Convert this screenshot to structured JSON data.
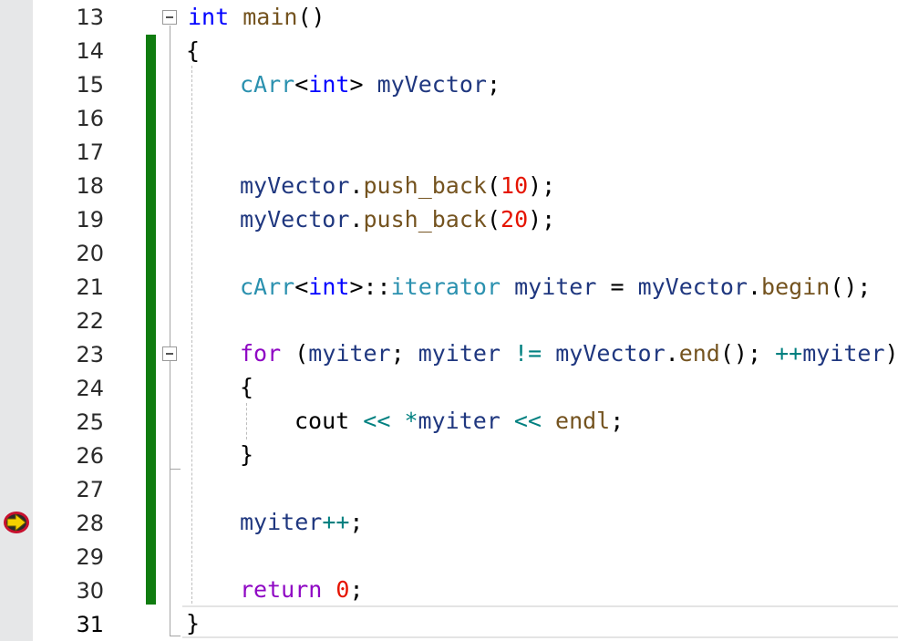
{
  "line_numbers": [
    "13",
    "14",
    "15",
    "16",
    "17",
    "18",
    "19",
    "20",
    "21",
    "22",
    "23",
    "24",
    "25",
    "26",
    "27",
    "28",
    "29",
    "30",
    "31"
  ],
  "current_line": "31",
  "breakpoint_line": "28",
  "colors": {
    "change_bar": "#107c10",
    "keyword": "#0000ff",
    "control_keyword": "#8f08c4",
    "type": "#2b91af",
    "function": "#74531f",
    "number": "#e51400",
    "operator": "#008080",
    "variable": "#1f377f"
  },
  "code": {
    "l13": {
      "kw": "int",
      "fn": "main",
      "rest": "()"
    },
    "l14": {
      "text": "{"
    },
    "l15": {
      "type": "cArr",
      "lt": "<",
      "kw": "int",
      "gt": ">",
      "var": "myVector",
      "semi": ";"
    },
    "l18": {
      "var": "myVector",
      "dot": ".",
      "fn": "push_back",
      "open": "(",
      "num": "10",
      "close": ");"
    },
    "l19": {
      "var": "myVector",
      "dot": ".",
      "fn": "push_back",
      "open": "(",
      "num": "20",
      "close": ");"
    },
    "l21": {
      "type": "cArr",
      "lt": "<",
      "kw": "int",
      "gt": ">",
      "scope": "::",
      "type2": "iterator",
      "var": "myiter",
      "eq": " = ",
      "var2": "myVector",
      "dot": ".",
      "fn": "begin",
      "end": "();"
    },
    "l23": {
      "kw": "for",
      "open": " (",
      "var": "myiter",
      "semi": "; ",
      "var2": "myiter",
      "neq": " != ",
      "var3": "myVector",
      "dot": ".",
      "fn": "end",
      "mid": "(); ",
      "inc": "++",
      "var4": "myiter",
      "close": ")"
    },
    "l24": {
      "text": "{"
    },
    "l25": {
      "var": "cout",
      "op1": " << ",
      "op2": "*",
      "var2": "myiter",
      "op3": " << ",
      "fn": "endl",
      "semi": ";"
    },
    "l26": {
      "text": "}"
    },
    "l28": {
      "var": "myiter",
      "op": "++",
      "semi": ";"
    },
    "l30": {
      "kw": "return",
      "sp": " ",
      "num": "0",
      "semi": ";"
    },
    "l31": {
      "text": "}"
    }
  }
}
